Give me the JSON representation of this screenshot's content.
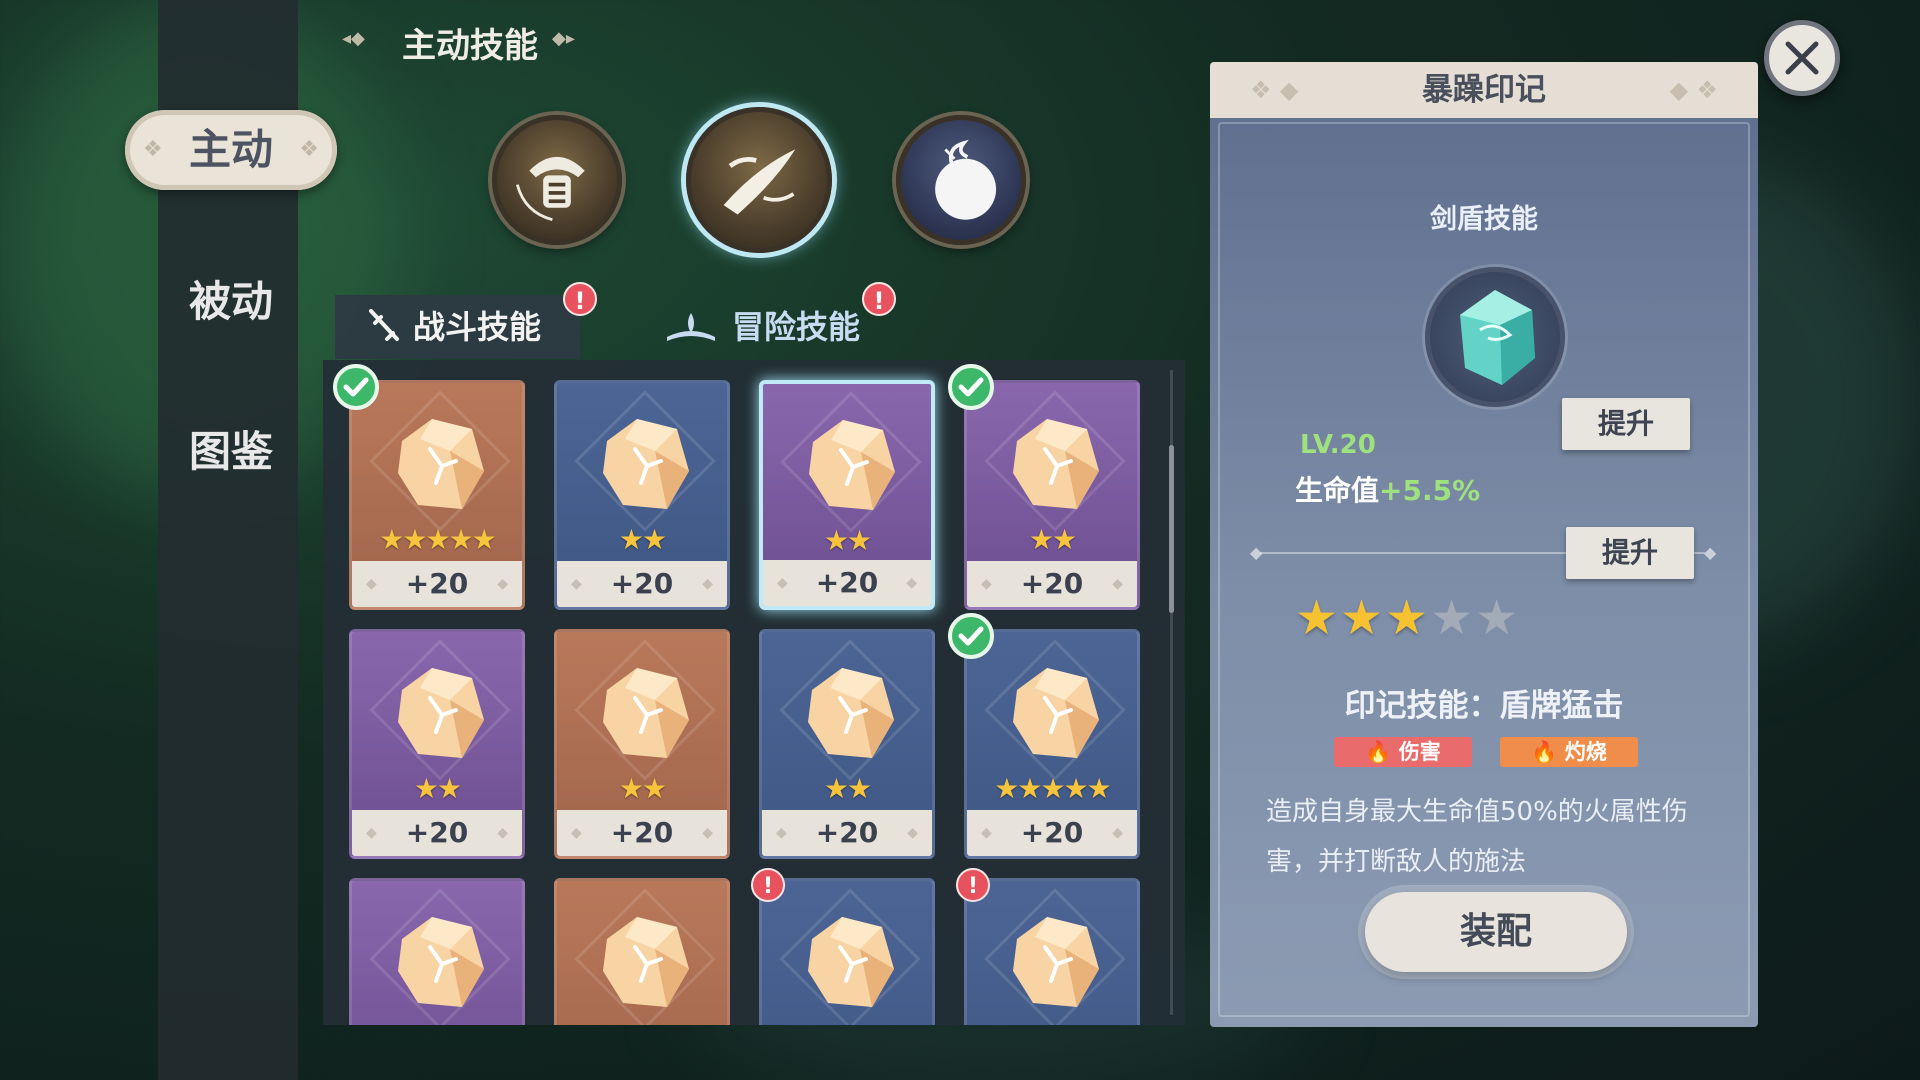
{
  "sidebar": {
    "items": [
      {
        "label": "主动"
      },
      {
        "label": "被动"
      },
      {
        "label": "图鉴"
      }
    ]
  },
  "section_title": "主动技能",
  "tabs": [
    {
      "label": "战斗技能",
      "alert": "!"
    },
    {
      "label": "冒险技能",
      "alert": "!"
    }
  ],
  "cards": [
    {
      "color": "orange",
      "stars": "★★★★★",
      "bonus": "+20",
      "checked": true
    },
    {
      "color": "blue",
      "stars": "★★",
      "bonus": "+20",
      "checked": false
    },
    {
      "color": "purple",
      "stars": "★★",
      "bonus": "+20",
      "checked": false,
      "selected": true
    },
    {
      "color": "purple",
      "stars": "★★",
      "bonus": "+20",
      "checked": true
    },
    {
      "color": "purple",
      "stars": "★★",
      "bonus": "+20",
      "checked": false
    },
    {
      "color": "orange",
      "stars": "★★",
      "bonus": "+20",
      "checked": false
    },
    {
      "color": "blue",
      "stars": "★★",
      "bonus": "+20",
      "checked": false
    },
    {
      "color": "blue",
      "stars": "★★★★★",
      "bonus": "+20",
      "checked": true
    },
    {
      "color": "purple",
      "stars": "",
      "bonus": "",
      "checked": false
    },
    {
      "color": "orange",
      "stars": "",
      "bonus": "",
      "checked": false
    },
    {
      "color": "blue",
      "stars": "",
      "bonus": "",
      "checked": false,
      "alert": "!"
    },
    {
      "color": "blue",
      "stars": "",
      "bonus": "",
      "checked": false,
      "alert": "!"
    }
  ],
  "detail": {
    "title": "暴躁印记",
    "subtitle": "剑盾技能",
    "level": "LV.20",
    "stat_label": "生命值",
    "stat_value": "+5.5%",
    "upgrade_label_1": "提升",
    "upgrade_label_2": "提升",
    "stars_filled": 3,
    "stars_total": 5,
    "skill_name": "印记技能：盾牌猛击",
    "tags": [
      "伤害",
      "灼烧"
    ],
    "description": "造成自身最大生命值50%的火属性伤害，并打断敌人的施法",
    "equip_label": "装配"
  },
  "colors": {
    "accent_green": "#9fe07f",
    "star_gold": "#f6c232",
    "alert_red": "#e8525e",
    "check_green": "#3db86a"
  }
}
